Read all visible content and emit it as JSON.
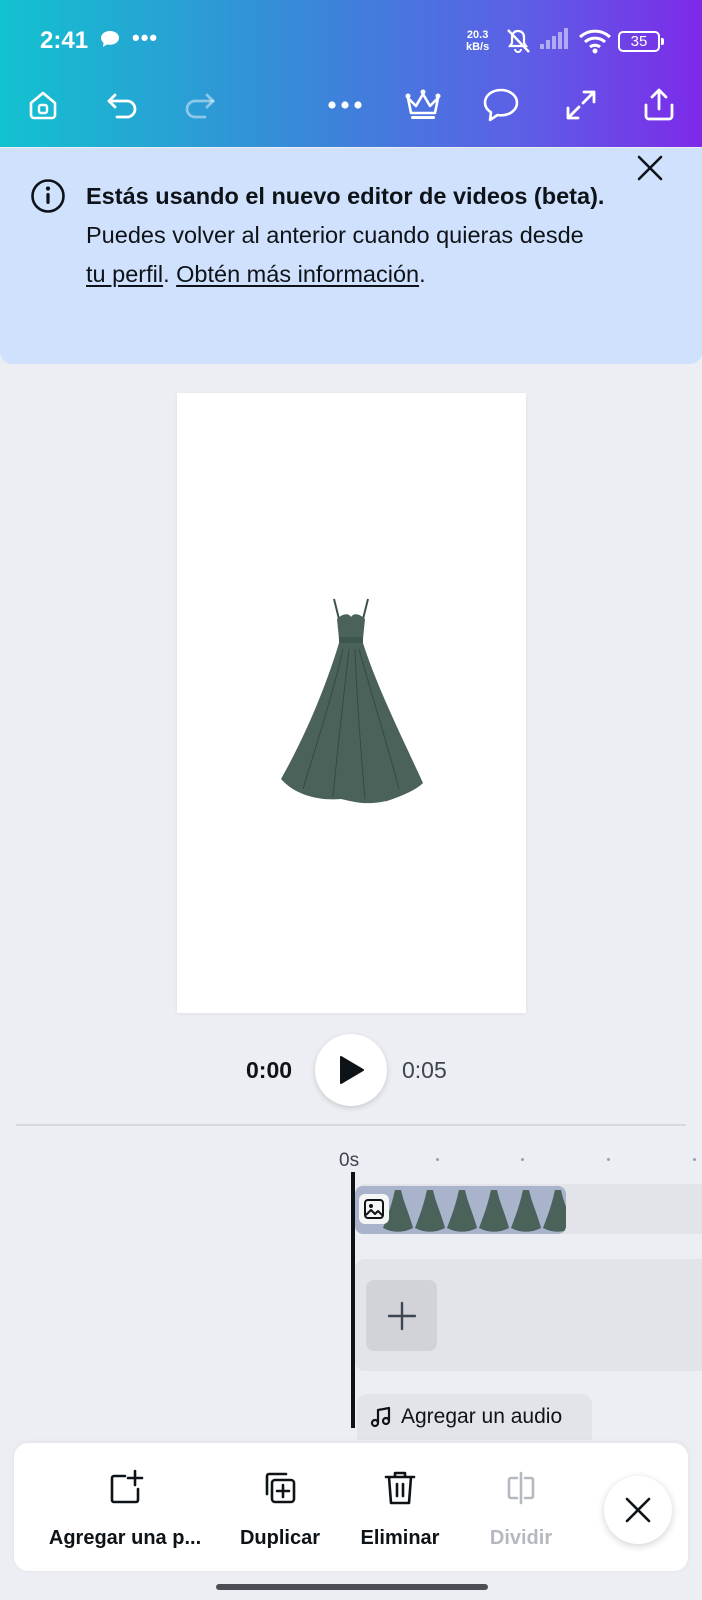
{
  "status_bar": {
    "time": "2:41",
    "more": "•••",
    "speed": [
      "20.3",
      "kB/s"
    ],
    "battery": "35"
  },
  "toolbar": {
    "icons": [
      "home-icon",
      "undo-icon",
      "redo-icon",
      "more-icon",
      "crown-icon",
      "comment-icon",
      "expand-icon",
      "share-icon"
    ]
  },
  "banner": {
    "bold": "Estás usando el nuevo editor de videos (beta).",
    "text1": " Puedes volver al anterior cuando quieras desde ",
    "link1": "tu perfil",
    "text2": ". ",
    "link2": "Obtén más información",
    "text3": "."
  },
  "playback": {
    "current": "0:00",
    "total": "0:05"
  },
  "timeline": {
    "ruler_label": "0s",
    "audio_label": "Agregar un audio"
  },
  "actions": {
    "add_page": "Agregar una p...",
    "duplicate": "Duplicar",
    "delete": "Eliminar",
    "split": "Dividir"
  },
  "colors": {
    "dress": "#4b625b",
    "accent_gradient": [
      "#12c2cf",
      "#7d2ae8"
    ],
    "banner": "#cfe1fd"
  }
}
